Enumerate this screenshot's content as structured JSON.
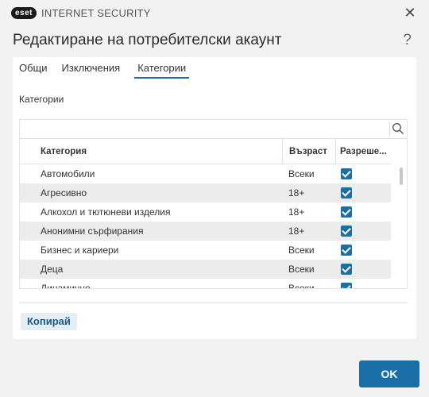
{
  "app": {
    "logo_text": "eset",
    "product_name": "INTERNET SECURITY",
    "close_glyph": "✕"
  },
  "dialog": {
    "title": "Редактиране на потребителски акаунт",
    "help_glyph": "?"
  },
  "tabs": [
    {
      "label": "Общи",
      "active": false
    },
    {
      "label": "Изключения",
      "active": false
    },
    {
      "label": "Категории",
      "active": true
    }
  ],
  "section_label": "Категории",
  "search": {
    "value": "",
    "placeholder": ""
  },
  "table": {
    "headers": {
      "category": "Категория",
      "age": "Възраст",
      "allowed": "Разреше..."
    },
    "rows": [
      {
        "category": "Автомобили",
        "age": "Всеки",
        "allowed": true
      },
      {
        "category": "Агресивно",
        "age": "18+",
        "allowed": true
      },
      {
        "category": "Алкохол и тютюневи изделия",
        "age": "18+",
        "allowed": true
      },
      {
        "category": "Анонимни сърфирания",
        "age": "18+",
        "allowed": true
      },
      {
        "category": "Бизнес и кариери",
        "age": "Всеки",
        "allowed": true
      },
      {
        "category": "Деца",
        "age": "Всеки",
        "allowed": true
      },
      {
        "category": "Динамично",
        "age": "Всеки",
        "allowed": true
      }
    ]
  },
  "buttons": {
    "copy": "Копирай",
    "ok": "OK"
  },
  "colors": {
    "accent": "#1a6fa6",
    "background": "#f2f2f2",
    "panel": "#ffffff"
  }
}
